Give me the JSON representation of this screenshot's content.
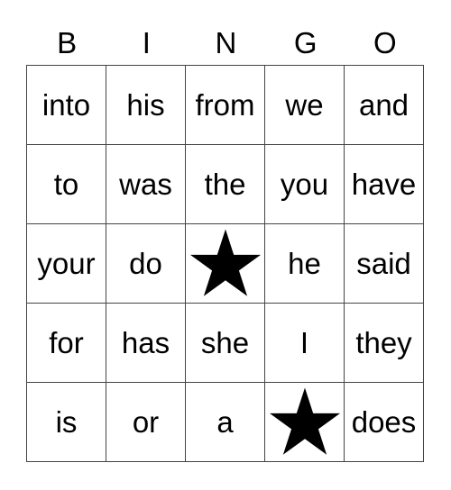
{
  "header": [
    "B",
    "I",
    "N",
    "G",
    "O"
  ],
  "rows": [
    [
      "into",
      "his",
      "from",
      "we",
      "and"
    ],
    [
      "to",
      "was",
      "the",
      "you",
      "have"
    ],
    [
      "your",
      "do",
      "*",
      "he",
      "said"
    ],
    [
      "for",
      "has",
      "she",
      "I",
      "they"
    ],
    [
      "is",
      "or",
      "a",
      "*",
      "does"
    ]
  ],
  "free_icon": "star-icon",
  "colors": {
    "grid": "#444444",
    "star": "#000000"
  }
}
